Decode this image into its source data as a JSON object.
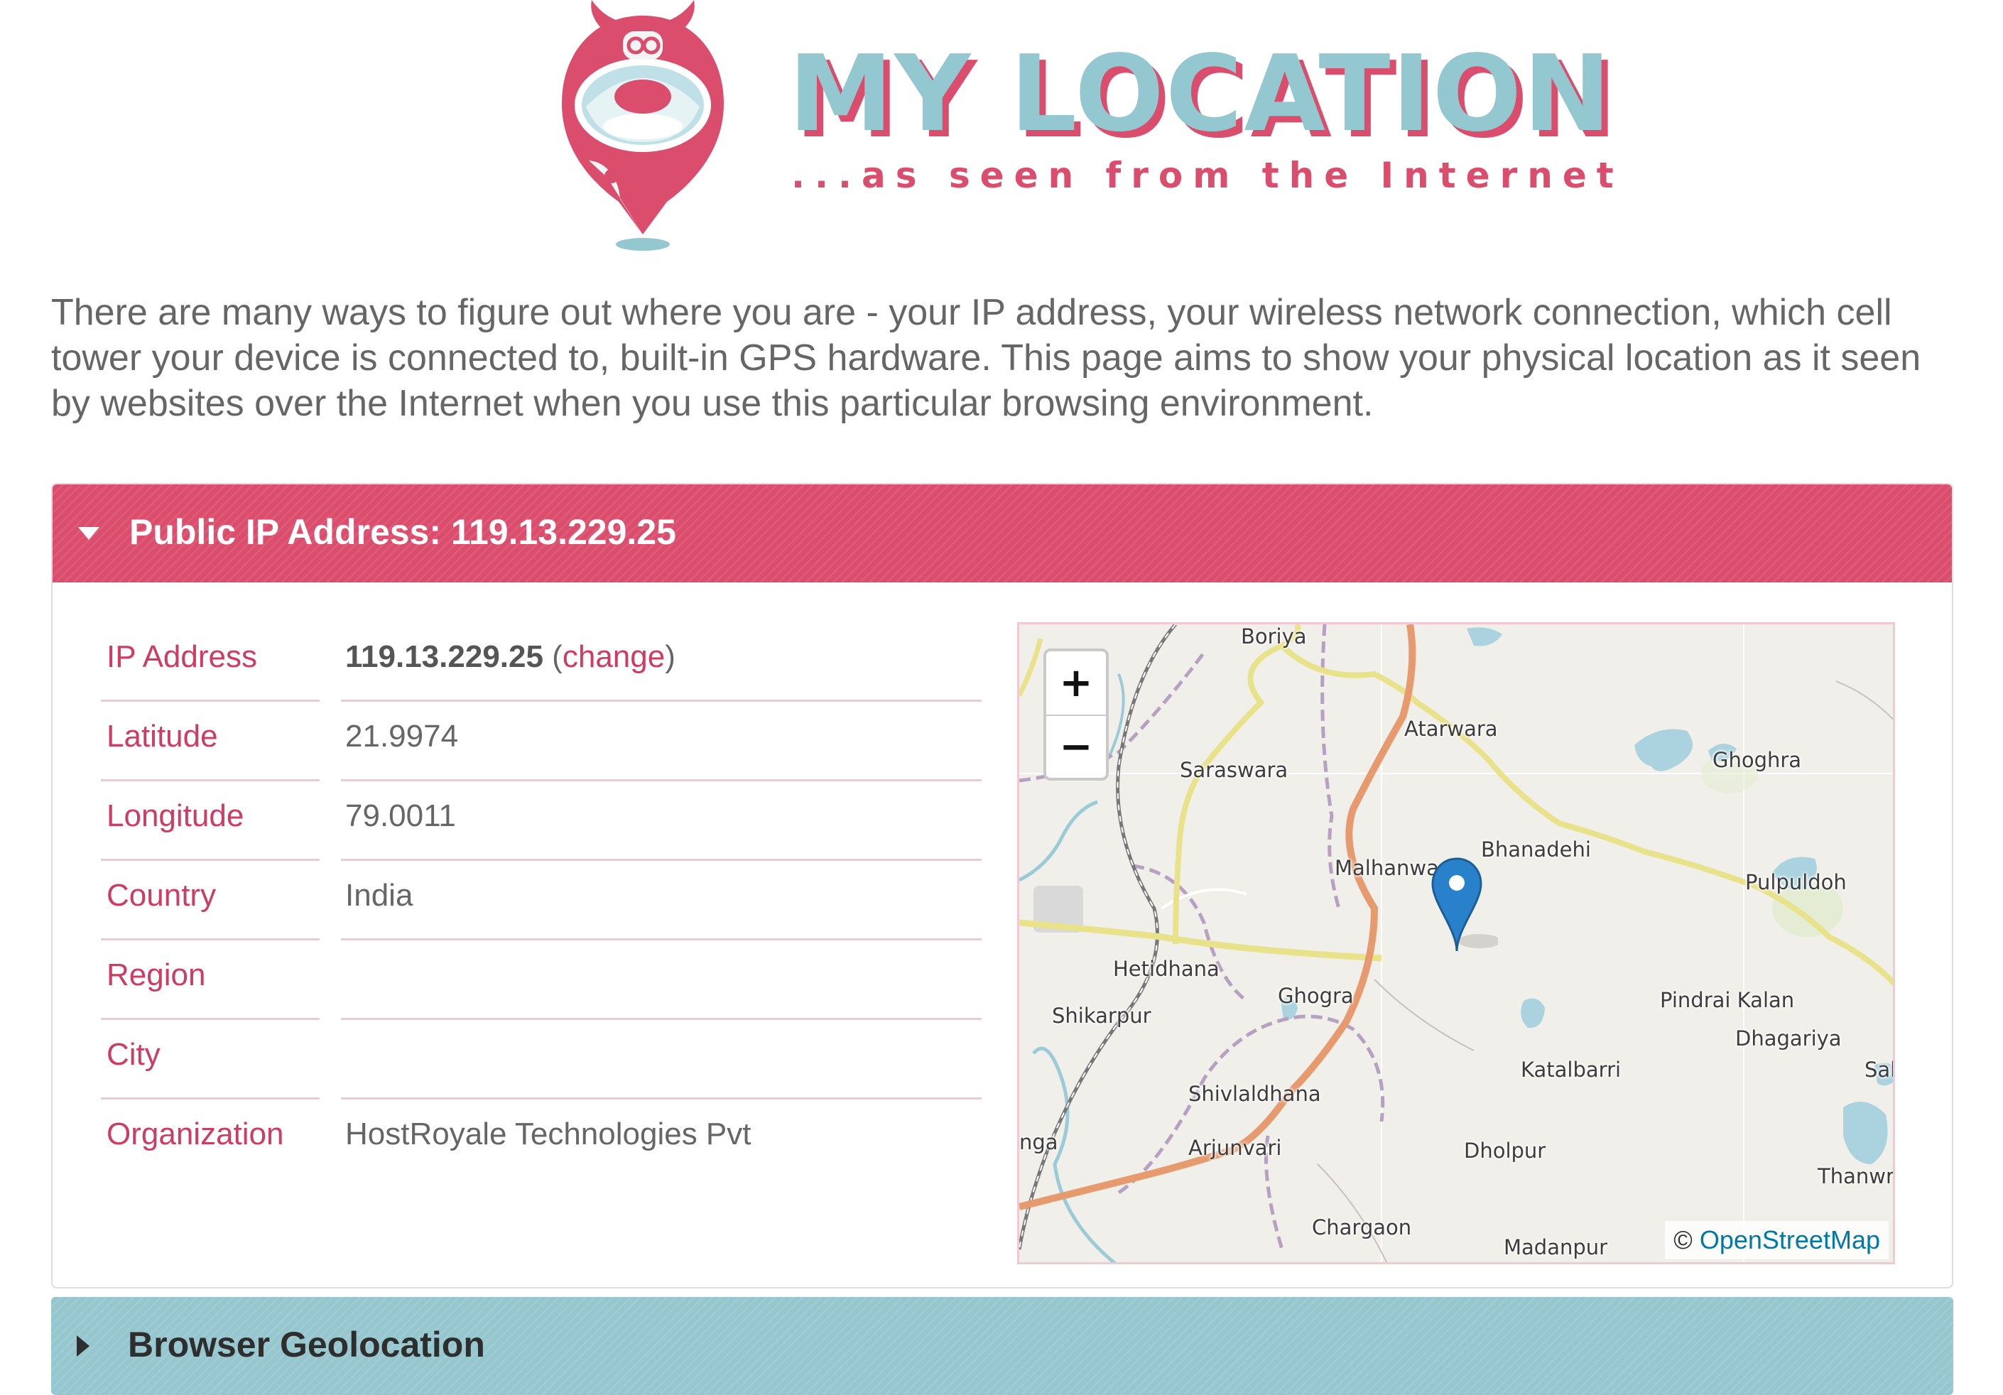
{
  "logo": {
    "title": "MY LOCATION",
    "tagline": "...as seen from the Internet"
  },
  "intro": "There are many ways to figure out where you are - your IP address, your wireless network connection, which cell tower your device is connected to, built-in GPS hardware. This page aims to show your physical location as it seen by websites over the Internet when you use this particular browsing environment.",
  "ip_panel": {
    "title": "Public IP Address: 119.13.229.25",
    "expanded": true,
    "rows": [
      {
        "label": "IP Address",
        "value": "119.13.229.25",
        "link": "change"
      },
      {
        "label": "Latitude",
        "value": "21.9974"
      },
      {
        "label": "Longitude",
        "value": "79.0011"
      },
      {
        "label": "Country",
        "value": "India"
      },
      {
        "label": "Region",
        "value": ""
      },
      {
        "label": "City",
        "value": ""
      },
      {
        "label": "Organization",
        "value": "HostRoyale Technologies Pvt"
      }
    ]
  },
  "map": {
    "zoom_in": "+",
    "zoom_out": "−",
    "attribution_prefix": "©",
    "attribution_link": "OpenStreetMap",
    "places": [
      "Boriya",
      "Atarwara",
      "Saraswara",
      "Ghoghra",
      "Bhanadehi",
      "Malhanwa",
      "Pulpuldoh",
      "Hetidhana",
      "Ghogra",
      "Shikarpur",
      "Pindrai Kalan",
      "Dhagariya",
      "Katalbarri",
      "Sal",
      "Shivlaldhana",
      "nga",
      "Arjunvari",
      "Dholpur",
      "Thanwr",
      "Chargaon",
      "Madanpur"
    ]
  },
  "geo_panel": {
    "title": "Browser Geolocation",
    "expanded": false
  },
  "colors": {
    "brand_pink": "#db4d6d",
    "brand_teal": "#96c6ce",
    "label_pink": "#cc3c63",
    "link_blue": "#0078a8"
  }
}
